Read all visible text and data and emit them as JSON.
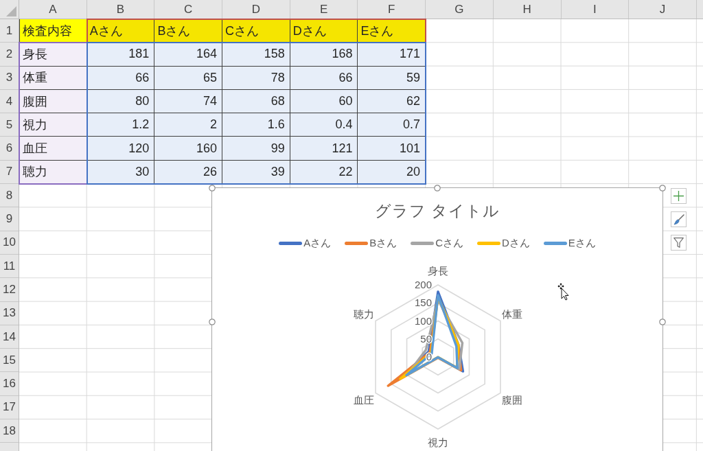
{
  "sheet": {
    "column_headers": [
      "A",
      "B",
      "C",
      "D",
      "E",
      "F",
      "G",
      "H",
      "I",
      "J"
    ],
    "row_headers": [
      "1",
      "2",
      "3",
      "4",
      "5",
      "6",
      "7",
      "8",
      "9",
      "10",
      "11",
      "12",
      "13",
      "14",
      "15",
      "16",
      "17",
      "18"
    ],
    "cells": [
      [
        "検査内容",
        "Aさん",
        "Bさん",
        "Cさん",
        "Dさん",
        "Eさん"
      ],
      [
        "身長",
        "181",
        "164",
        "158",
        "168",
        "171"
      ],
      [
        "体重",
        "66",
        "65",
        "78",
        "66",
        "59"
      ],
      [
        "腹囲",
        "80",
        "74",
        "68",
        "60",
        "62"
      ],
      [
        "視力",
        "1.2",
        "2",
        "1.6",
        "0.4",
        "0.7"
      ],
      [
        "血圧",
        "120",
        "160",
        "99",
        "121",
        "101"
      ],
      [
        "聴力",
        "30",
        "26",
        "39",
        "22",
        "20"
      ]
    ]
  },
  "chart": {
    "selected": true,
    "chart_data": {
      "type": "radar",
      "title": "グラフ タイトル",
      "categories": [
        "身長",
        "体重",
        "腹囲",
        "視力",
        "血圧",
        "聴力"
      ],
      "ylim": [
        0,
        200
      ],
      "yticks": [
        0,
        50,
        100,
        150,
        200
      ],
      "series": [
        {
          "name": "Aさん",
          "color": "#4472c4",
          "values": [
            181,
            66,
            80,
            1.2,
            120,
            30
          ]
        },
        {
          "name": "Bさん",
          "color": "#ed7d31",
          "values": [
            164,
            65,
            74,
            2,
            160,
            26
          ]
        },
        {
          "name": "Cさん",
          "color": "#a5a5a5",
          "values": [
            158,
            78,
            68,
            1.6,
            99,
            39
          ]
        },
        {
          "name": "Dさん",
          "color": "#ffc000",
          "values": [
            168,
            66,
            60,
            0.4,
            121,
            22
          ]
        },
        {
          "name": "Eさん",
          "color": "#5b9bd5",
          "values": [
            171,
            59,
            62,
            0.7,
            101,
            20
          ]
        }
      ]
    }
  }
}
